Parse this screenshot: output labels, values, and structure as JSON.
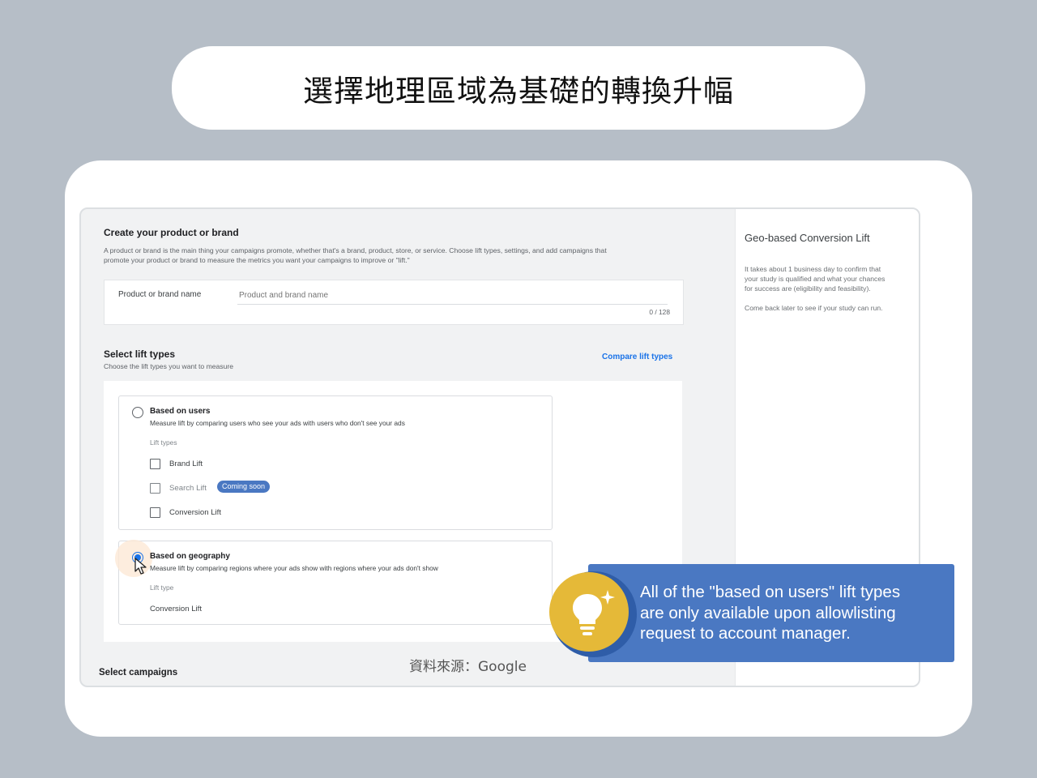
{
  "slide_title": "選擇地理區域為基礎的轉換升幅",
  "form": {
    "create": {
      "heading": "Create your product or brand",
      "description_line1": "A product or brand is the main thing your campaigns promote, whether that's a brand, product, store, or service. Choose lift types, settings, and add campaigns that",
      "description_line2": "promote your product or brand to measure the metrics you want your campaigns to improve or \"lift.\""
    },
    "brand_field": {
      "label": "Product or brand name",
      "placeholder": "Product and brand name",
      "value": "",
      "counter": "0 / 128"
    },
    "lift_types": {
      "heading": "Select lift types",
      "subheading": "Choose the lift types you want to measure",
      "compare_link": "Compare lift types",
      "options": [
        {
          "title": "Based on users",
          "description": "Measure lift by comparing users who see your ads with users who don't see your ads",
          "sub_label": "Lift types",
          "selected": false,
          "checkboxes": [
            {
              "label": "Brand Lift",
              "checked": false,
              "disabled": false
            },
            {
              "label": "Search Lift",
              "checked": false,
              "disabled": true,
              "badge": "Coming soon"
            },
            {
              "label": "Conversion Lift",
              "checked": false,
              "disabled": false
            }
          ]
        },
        {
          "title": "Based on geography",
          "description": "Measure lift by comparing regions where your ads show with regions where your ads don't show",
          "sub_label": "Lift type",
          "selected": true,
          "lift_type_value": "Conversion Lift"
        }
      ]
    },
    "campaigns_heading": "Select campaigns"
  },
  "side_panel": {
    "title": "Geo-based Conversion Lift",
    "para1_line1": "It takes about 1 business day to confirm that",
    "para1_line2": "your study is qualified and what your chances",
    "para1_line3": "for success are (eligibility and feasibility).",
    "para2": "Come back later to see if your study can run."
  },
  "callout": {
    "line1": "All of the \"based on users\" lift types",
    "line2": "are only available upon allowlisting",
    "line3": "request to account manager.",
    "icon": "lightbulb-icon"
  },
  "source_caption": "資料來源：Google",
  "colors": {
    "background": "#b6bec7",
    "link_blue": "#1a73e8",
    "callout_blue": "#4a78c2",
    "bulb_yellow": "#e5b938",
    "badge_blue": "#4a78c2"
  }
}
